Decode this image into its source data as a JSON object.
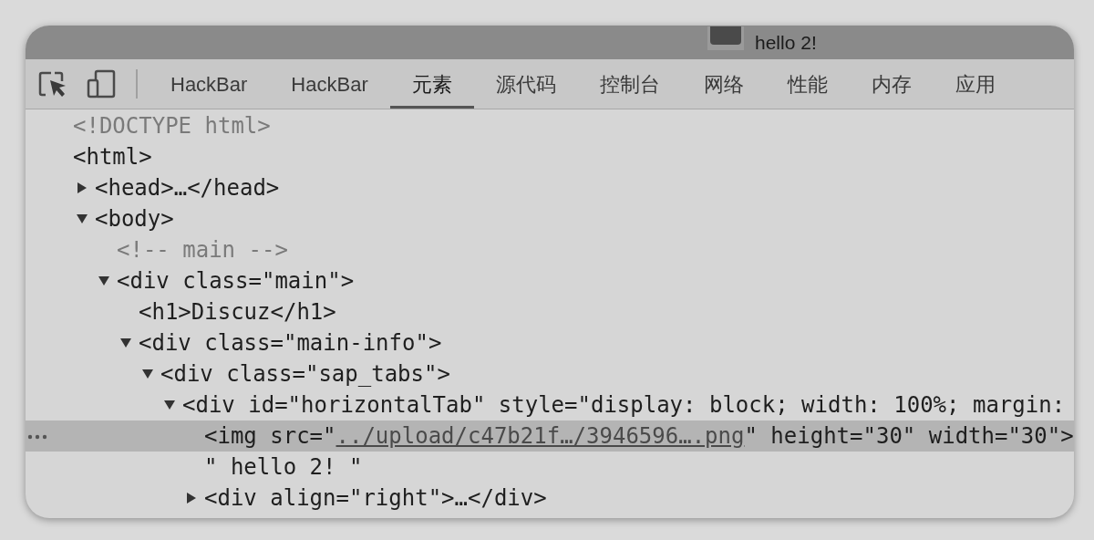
{
  "page_tab": {
    "title": "hello 2!"
  },
  "tabs": [
    {
      "label": "HackBar",
      "selected": false
    },
    {
      "label": "HackBar",
      "selected": false
    },
    {
      "label": "元素",
      "selected": true
    },
    {
      "label": "源代码",
      "selected": false
    },
    {
      "label": "控制台",
      "selected": false
    },
    {
      "label": "网络",
      "selected": false
    },
    {
      "label": "性能",
      "selected": false
    },
    {
      "label": "内存",
      "selected": false
    },
    {
      "label": "应用",
      "selected": false
    }
  ],
  "dom_tree": [
    {
      "parts": [
        {
          "text": "<!DOCTYPE html>",
          "kind": "muted"
        }
      ],
      "selected": false
    },
    {
      "parts": [
        {
          "text": "<html>",
          "kind": "plain"
        }
      ],
      "selected": false,
      "children": [
        {
          "parts": [
            {
              "text": "<head>…</head>",
              "kind": "plain"
            }
          ],
          "selected": false,
          "expanded": false
        },
        {
          "parts": [
            {
              "text": "<body>",
              "kind": "plain"
            }
          ],
          "selected": false,
          "expanded": true,
          "children": [
            {
              "parts": [
                {
                  "text": "<!-- main -->",
                  "kind": "muted"
                }
              ],
              "selected": false
            },
            {
              "parts": [
                {
                  "text": "<div class=\"main\">",
                  "kind": "plain"
                }
              ],
              "selected": false,
              "expanded": true,
              "children": [
                {
                  "parts": [
                    {
                      "text": "<h1>Discuz</h1>",
                      "kind": "plain"
                    }
                  ],
                  "selected": false
                },
                {
                  "parts": [
                    {
                      "text": "<div class=\"main-info\">",
                      "kind": "plain"
                    }
                  ],
                  "selected": false,
                  "expanded": true,
                  "children": [
                    {
                      "parts": [
                        {
                          "text": "<div class=\"sap_tabs\">",
                          "kind": "plain"
                        }
                      ],
                      "selected": false,
                      "expanded": true,
                      "children": [
                        {
                          "parts": [
                            {
                              "text": "<div id=\"horizontalTab\" style=\"display: block; width: 100%; margin:",
                              "kind": "plain"
                            }
                          ],
                          "selected": false,
                          "expanded": true,
                          "children": [
                            {
                              "parts": [
                                {
                                  "text": "<img src=\"",
                                  "kind": "plain"
                                },
                                {
                                  "text": "../upload/c47b21f…/3946596….png",
                                  "kind": "link"
                                },
                                {
                                  "text": "\" height=\"30\" width=\"30\">",
                                  "kind": "plain"
                                }
                              ],
                              "selected": true
                            },
                            {
                              "parts": [
                                {
                                  "text": "\" hello 2! \"",
                                  "kind": "plain"
                                }
                              ],
                              "selected": false
                            },
                            {
                              "parts": [
                                {
                                  "text": "<div align=\"right\">…</div>",
                                  "kind": "plain"
                                }
                              ],
                              "selected": false,
                              "expanded": false
                            }
                          ]
                        }
                      ]
                    }
                  ]
                }
              ]
            }
          ]
        }
      ]
    }
  ]
}
